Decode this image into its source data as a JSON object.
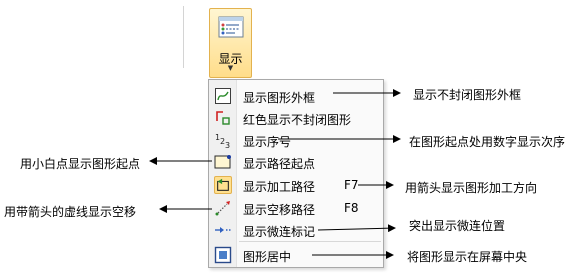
{
  "ribbon": {
    "display_button": {
      "label": "显示",
      "icon": "display-icon"
    }
  },
  "menu": {
    "items": [
      {
        "label": "显示图形外框",
        "icon": "outline-icon",
        "shortcut": ""
      },
      {
        "label": "红色显示不封闭图形",
        "icon": "open-shape-icon",
        "shortcut": ""
      },
      {
        "label": "显示序号",
        "icon": "sequence-number-icon",
        "shortcut": ""
      },
      {
        "label": "显示路径起点",
        "icon": "path-start-icon",
        "shortcut": ""
      },
      {
        "label": "显示加工路径",
        "icon": "machining-path-icon",
        "shortcut": "F7"
      },
      {
        "label": "显示空移路径",
        "icon": "idle-path-icon",
        "shortcut": "F8"
      },
      {
        "label": "显示微连标记",
        "icon": "micro-joint-icon",
        "shortcut": ""
      },
      {
        "label": "图形居中",
        "icon": "center-icon",
        "shortcut": ""
      }
    ]
  },
  "callouts": {
    "outline": "显示不封闭图形外框",
    "sequence": "在图形起点处用数字显示次序",
    "start_point": "用小白点显示图形起点",
    "machining_path": "用箭头显示图形加工方向",
    "idle_path": "用带箭头的虚线显示空移",
    "micro_joint": "突出显示微连位置",
    "center": "将图形显示在屏幕中央"
  },
  "colors": {
    "accent": "#ffdd8a",
    "arrow": "#000000"
  }
}
